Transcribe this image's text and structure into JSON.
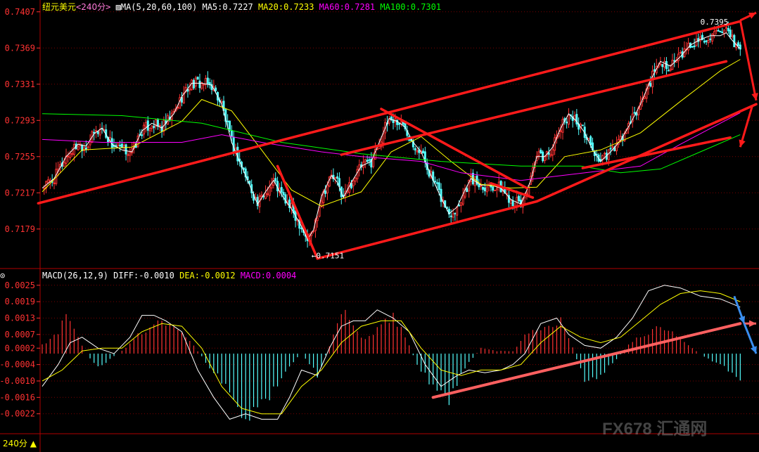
{
  "symbol": "纽元美元",
  "period": "240分",
  "timeframe_label": "240分",
  "watermark": "FX678 汇通网",
  "indicators": {
    "ma": {
      "name": "MA(5,20,60,100)",
      "ma5": "MA5:0.7227",
      "ma20": "MA20:0.7233",
      "ma60": "MA60:0.7281",
      "ma100": "MA100:0.7301"
    },
    "macd": {
      "name": "MACD(26,12,9)",
      "diff": "DIFF:-0.0010",
      "dea": "DEA:-0.0012",
      "macd": "MACD:0.0004"
    }
  },
  "colors": {
    "up": "#ff3232",
    "down": "#54ffff",
    "ma5": "#ffffff",
    "ma20": "#ffff00",
    "ma60": "#ff00ff",
    "ma100": "#00ff00",
    "trend": "#ff1a1a",
    "trend_macd": "#ff6060",
    "arrow_blue": "#3a8ef0",
    "grid": "#7a0000",
    "axis_text": "#ff3232"
  },
  "chart_data": [
    {
      "type": "candlestick",
      "title": "纽元美元",
      "yticks": [
        0.7407,
        0.7369,
        0.7331,
        0.7293,
        0.7255,
        0.7217,
        0.7179
      ],
      "ylim": [
        0.7139,
        0.7412
      ],
      "grid": true,
      "annotations": [
        {
          "label": "0.7395",
          "value": 0.7395
        },
        {
          "label": "0.7151",
          "value": 0.7151
        }
      ],
      "close_path": [
        [
          0,
          0.7222
        ],
        [
          6,
          0.7232
        ],
        [
          12,
          0.7255
        ],
        [
          18,
          0.7268
        ],
        [
          22,
          0.7266
        ],
        [
          26,
          0.7279
        ],
        [
          30,
          0.7285
        ],
        [
          35,
          0.7268
        ],
        [
          40,
          0.7262
        ],
        [
          45,
          0.726
        ],
        [
          50,
          0.7282
        ],
        [
          55,
          0.729
        ],
        [
          60,
          0.7285
        ],
        [
          66,
          0.73
        ],
        [
          70,
          0.7318
        ],
        [
          75,
          0.7332
        ],
        [
          80,
          0.7332
        ],
        [
          85,
          0.733
        ],
        [
          90,
          0.731
        ],
        [
          95,
          0.727
        ],
        [
          100,
          0.7245
        ],
        [
          105,
          0.722
        ],
        [
          108,
          0.7205
        ],
        [
          112,
          0.7218
        ],
        [
          116,
          0.723
        ],
        [
          120,
          0.7215
        ],
        [
          125,
          0.72
        ],
        [
          130,
          0.7182
        ],
        [
          133,
          0.7168
        ],
        [
          136,
          0.7178
        ],
        [
          140,
          0.7213
        ],
        [
          145,
          0.7235
        ],
        [
          148,
          0.7228
        ],
        [
          151,
          0.7212
        ],
        [
          155,
          0.7228
        ],
        [
          160,
          0.7245
        ],
        [
          165,
          0.725
        ],
        [
          170,
          0.7275
        ],
        [
          174,
          0.7295
        ],
        [
          178,
          0.7292
        ],
        [
          182,
          0.7286
        ],
        [
          186,
          0.727
        ],
        [
          190,
          0.726
        ],
        [
          195,
          0.7235
        ],
        [
          200,
          0.7212
        ],
        [
          204,
          0.7195
        ],
        [
          208,
          0.7202
        ],
        [
          212,
          0.722
        ],
        [
          215,
          0.7232
        ],
        [
          220,
          0.7225
        ],
        [
          225,
          0.7225
        ],
        [
          230,
          0.7222
        ],
        [
          235,
          0.721
        ],
        [
          240,
          0.7205
        ],
        [
          245,
          0.723
        ],
        [
          248,
          0.7255
        ],
        [
          252,
          0.7255
        ],
        [
          256,
          0.7265
        ],
        [
          260,
          0.7285
        ],
        [
          264,
          0.73
        ],
        [
          268,
          0.7292
        ],
        [
          272,
          0.728
        ],
        [
          276,
          0.7262
        ],
        [
          280,
          0.725
        ],
        [
          285,
          0.726
        ],
        [
          290,
          0.7272
        ],
        [
          295,
          0.729
        ],
        [
          300,
          0.731
        ],
        [
          305,
          0.7335
        ],
        [
          310,
          0.7355
        ],
        [
          315,
          0.735
        ],
        [
          320,
          0.736
        ],
        [
          325,
          0.7372
        ],
        [
          330,
          0.7378
        ],
        [
          335,
          0.7382
        ],
        [
          340,
          0.7382
        ],
        [
          343,
          0.7385
        ],
        [
          346,
          0.7377
        ],
        [
          350,
          0.7368
        ]
      ],
      "ma_lines": [
        {
          "name": "MA20",
          "points": [
            [
              0,
              0.7218
            ],
            [
              20,
              0.7262
            ],
            [
              45,
              0.7265
            ],
            [
              70,
              0.7292
            ],
            [
              80,
              0.7315
            ],
            [
              95,
              0.7303
            ],
            [
              110,
              0.7262
            ],
            [
              125,
              0.722
            ],
            [
              140,
              0.7203
            ],
            [
              160,
              0.7218
            ],
            [
              175,
              0.726
            ],
            [
              190,
              0.7276
            ],
            [
              205,
              0.725
            ],
            [
              220,
              0.7226
            ],
            [
              235,
              0.7222
            ],
            [
              248,
              0.7223
            ],
            [
              262,
              0.7255
            ],
            [
              280,
              0.7262
            ],
            [
              300,
              0.728
            ],
            [
              320,
              0.7313
            ],
            [
              340,
              0.7345
            ],
            [
              350,
              0.7357
            ]
          ]
        },
        {
          "name": "MA60",
          "points": [
            [
              0,
              0.7273
            ],
            [
              30,
              0.727
            ],
            [
              70,
              0.727
            ],
            [
              90,
              0.7278
            ],
            [
              110,
              0.727
            ],
            [
              140,
              0.726
            ],
            [
              160,
              0.7255
            ],
            [
              190,
              0.725
            ],
            [
              210,
              0.7238
            ],
            [
              240,
              0.723
            ],
            [
              260,
              0.7235
            ],
            [
              280,
              0.724
            ],
            [
              300,
              0.7245
            ],
            [
              320,
              0.7268
            ],
            [
              340,
              0.729
            ],
            [
              350,
              0.7301
            ]
          ]
        },
        {
          "name": "MA100",
          "points": [
            [
              0,
              0.73
            ],
            [
              40,
              0.7298
            ],
            [
              80,
              0.729
            ],
            [
              120,
              0.727
            ],
            [
              160,
              0.7258
            ],
            [
              200,
              0.725
            ],
            [
              240,
              0.7245
            ],
            [
              270,
              0.7245
            ],
            [
              290,
              0.7238
            ],
            [
              310,
              0.7242
            ],
            [
              330,
              0.726
            ],
            [
              350,
              0.7278
            ]
          ]
        }
      ],
      "trend_lines": [
        [
          [
            -2,
            0.7206
          ],
          [
            350,
            0.7397
          ]
        ],
        [
          [
            118,
            0.7245
          ],
          [
            138,
            0.7148
          ]
        ],
        [
          [
            138,
            0.7148
          ],
          [
            248,
            0.7208
          ]
        ],
        [
          [
            248,
            0.7208
          ],
          [
            358,
            0.731
          ]
        ],
        [
          [
            150,
            0.7257
          ],
          [
            343,
            0.7355
          ]
        ],
        [
          [
            170,
            0.7305
          ],
          [
            243,
            0.7222
          ]
        ],
        [
          [
            225,
            0.7227
          ],
          [
            246,
            0.7212
          ]
        ],
        [
          [
            271,
            0.7243
          ],
          [
            345,
            0.7275
          ]
        ]
      ],
      "arrows": [
        {
          "from": [
            350,
            0.7398
          ],
          "to": [
            358,
            0.7406
          ]
        },
        {
          "from": [
            350,
            0.7398
          ],
          "to": [
            358,
            0.7314
          ]
        },
        {
          "from": [
            356,
            0.7308
          ],
          "to": [
            350,
            0.7265
          ]
        }
      ]
    },
    {
      "type": "macd",
      "title": "MACD(26,12,9)",
      "yticks": [
        0.0025,
        0.0019,
        0.0013,
        0.0007,
        0.0002,
        -0.0004,
        -0.001,
        -0.0016,
        -0.0022
      ],
      "ylim": [
        -0.0028,
        0.0027
      ],
      "grid": true,
      "hist_keys": [
        [
          0,
          0.0003
        ],
        [
          8,
          0.0008
        ],
        [
          12,
          0.0015
        ],
        [
          16,
          0.0008
        ],
        [
          22,
          0.0
        ],
        [
          28,
          -0.0005
        ],
        [
          34,
          -0.0002
        ],
        [
          42,
          0.0002
        ],
        [
          50,
          0.0008
        ],
        [
          58,
          0.0012
        ],
        [
          66,
          0.001
        ],
        [
          76,
          0.0003
        ],
        [
          84,
          -0.0005
        ],
        [
          92,
          -0.0012
        ],
        [
          102,
          -0.0025
        ],
        [
          112,
          -0.0018
        ],
        [
          122,
          -0.0006
        ],
        [
          130,
          0.0
        ],
        [
          138,
          -0.0008
        ],
        [
          144,
          0.0003
        ],
        [
          150,
          0.0016
        ],
        [
          156,
          0.001
        ],
        [
          162,
          0.0005
        ],
        [
          170,
          0.001
        ],
        [
          176,
          0.0014
        ],
        [
          182,
          0.0006
        ],
        [
          188,
          -0.0004
        ],
        [
          196,
          -0.0012
        ],
        [
          204,
          -0.0017
        ],
        [
          212,
          -0.0005
        ],
        [
          220,
          0.0002
        ],
        [
          228,
          0.0001
        ],
        [
          236,
          0.0001
        ],
        [
          244,
          0.0008
        ],
        [
          252,
          0.001
        ],
        [
          260,
          0.0012
        ],
        [
          266,
          0.0002
        ],
        [
          272,
          -0.001
        ],
        [
          280,
          -0.0008
        ],
        [
          288,
          -0.0002
        ],
        [
          296,
          0.0005
        ],
        [
          304,
          0.0008
        ],
        [
          312,
          0.001
        ],
        [
          318,
          0.0006
        ],
        [
          326,
          0.0002
        ],
        [
          334,
          -0.0002
        ],
        [
          342,
          -0.0005
        ],
        [
          350,
          -0.001
        ]
      ],
      "diff_line": [
        [
          0,
          -0.0012
        ],
        [
          8,
          -0.0004
        ],
        [
          14,
          0.0004
        ],
        [
          20,
          0.0006
        ],
        [
          28,
          0.0002
        ],
        [
          36,
          0.0
        ],
        [
          44,
          0.0006
        ],
        [
          50,
          0.0014
        ],
        [
          56,
          0.0014
        ],
        [
          62,
          0.0012
        ],
        [
          70,
          0.0008
        ],
        [
          78,
          -0.0006
        ],
        [
          86,
          -0.0016
        ],
        [
          94,
          -0.0024
        ],
        [
          102,
          -0.0022
        ],
        [
          110,
          -0.0024
        ],
        [
          118,
          -0.0024
        ],
        [
          124,
          -0.0016
        ],
        [
          130,
          -0.0006
        ],
        [
          138,
          -0.0008
        ],
        [
          144,
          0.0002
        ],
        [
          150,
          0.001
        ],
        [
          156,
          0.0012
        ],
        [
          162,
          0.0012
        ],
        [
          168,
          0.0016
        ],
        [
          176,
          0.0013
        ],
        [
          184,
          0.0008
        ],
        [
          192,
          -0.0004
        ],
        [
          200,
          -0.0012
        ],
        [
          208,
          -0.0008
        ],
        [
          214,
          -0.0006
        ],
        [
          222,
          -0.0007
        ],
        [
          230,
          -0.0006
        ],
        [
          236,
          -0.0004
        ],
        [
          242,
          0.0
        ],
        [
          250,
          0.0011
        ],
        [
          258,
          0.0013
        ],
        [
          264,
          0.0007
        ],
        [
          272,
          0.0003
        ],
        [
          280,
          0.0002
        ],
        [
          288,
          0.0006
        ],
        [
          296,
          0.0013
        ],
        [
          304,
          0.0023
        ],
        [
          312,
          0.0025
        ],
        [
          320,
          0.0024
        ],
        [
          330,
          0.0021
        ],
        [
          340,
          0.002
        ],
        [
          350,
          0.0017
        ]
      ],
      "dea_line": [
        [
          0,
          -0.001
        ],
        [
          10,
          -0.0006
        ],
        [
          20,
          0.0001
        ],
        [
          30,
          0.0002
        ],
        [
          40,
          0.0002
        ],
        [
          50,
          0.0008
        ],
        [
          60,
          0.0011
        ],
        [
          70,
          0.001
        ],
        [
          80,
          0.0002
        ],
        [
          90,
          -0.0012
        ],
        [
          100,
          -0.002
        ],
        [
          110,
          -0.0022
        ],
        [
          120,
          -0.0022
        ],
        [
          130,
          -0.0012
        ],
        [
          140,
          -0.0006
        ],
        [
          150,
          0.0004
        ],
        [
          160,
          0.001
        ],
        [
          170,
          0.0012
        ],
        [
          180,
          0.0012
        ],
        [
          190,
          0.0002
        ],
        [
          200,
          -0.0006
        ],
        [
          210,
          -0.0008
        ],
        [
          220,
          -0.0006
        ],
        [
          230,
          -0.0006
        ],
        [
          240,
          -0.0004
        ],
        [
          250,
          0.0004
        ],
        [
          260,
          0.001
        ],
        [
          270,
          0.0006
        ],
        [
          280,
          0.0004
        ],
        [
          290,
          0.0006
        ],
        [
          300,
          0.0012
        ],
        [
          310,
          0.0018
        ],
        [
          320,
          0.0022
        ],
        [
          330,
          0.0023
        ],
        [
          340,
          0.0022
        ],
        [
          350,
          0.0019
        ]
      ],
      "trend_lines": [
        [
          [
            196,
            -0.0016
          ],
          [
            350,
            0.0011
          ]
        ]
      ],
      "arrows": [
        {
          "from": [
            347,
            0.0021
          ],
          "to": [
            352,
            0.0011
          ]
        },
        {
          "from": [
            352,
            0.0011
          ],
          "to": [
            358,
            0.0011
          ]
        },
        {
          "from": [
            352,
            0.0011
          ],
          "to": [
            358,
            0.0
          ]
        }
      ]
    }
  ]
}
